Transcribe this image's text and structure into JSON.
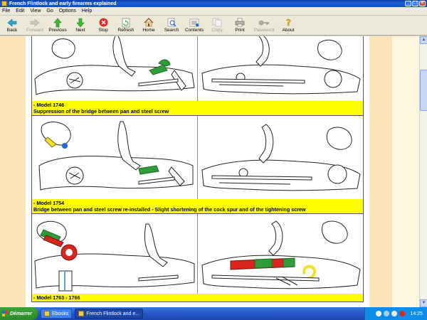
{
  "window": {
    "title": "French Flintlock and early firearms explained"
  },
  "menu": [
    "File",
    "Edit",
    "View",
    "Go",
    "Options",
    "Help"
  ],
  "toolbar": [
    {
      "label": "Back",
      "icon": "back-arrow-icon",
      "enabled": true
    },
    {
      "label": "Forward",
      "icon": "forward-arrow-icon",
      "enabled": false
    },
    {
      "label": "Previous",
      "icon": "previous-arrow-icon",
      "enabled": true
    },
    {
      "label": "Next",
      "icon": "next-arrow-icon",
      "enabled": true
    },
    {
      "label": "Stop",
      "icon": "stop-icon",
      "enabled": true
    },
    {
      "label": "Refresh",
      "icon": "refresh-icon",
      "enabled": true
    },
    {
      "label": "Home",
      "icon": "home-icon",
      "enabled": true
    },
    {
      "label": "Search",
      "icon": "search-icon",
      "enabled": true
    },
    {
      "label": "Contents",
      "icon": "contents-icon",
      "enabled": true
    },
    {
      "label": "Copy",
      "icon": "copy-icon",
      "enabled": false
    },
    {
      "label": "Print",
      "icon": "print-icon",
      "enabled": true
    },
    {
      "label": "Password",
      "icon": "password-key-icon",
      "enabled": false
    },
    {
      "label": "About",
      "icon": "about-icon",
      "enabled": true
    }
  ],
  "rows": [
    {
      "caption_dash": "- Model 1746",
      "caption_text": "Suppression of the bridge between pan and steel screw"
    },
    {
      "caption_dash": "- Model 1754",
      "caption_text": "Bridge between pan and steel screw re-installed - Slight shortening of the cock spur and of the tightening screw"
    },
    {
      "caption_dash": "- Model 1763 - 1766",
      "caption_text": ""
    }
  ],
  "taskbar": {
    "start_label": "Démarrer",
    "tasks": [
      {
        "label": "Ebooks",
        "active": false
      },
      {
        "label": "French Flintlock and e...",
        "active": true
      }
    ],
    "clock": "14:25"
  },
  "colors": {
    "caption_bg": "#ffff00",
    "page_band": "#fbe4b7",
    "highlight_green": "#2e9c39",
    "highlight_red": "#d7261e",
    "highlight_yellow": "#f2e12a"
  }
}
